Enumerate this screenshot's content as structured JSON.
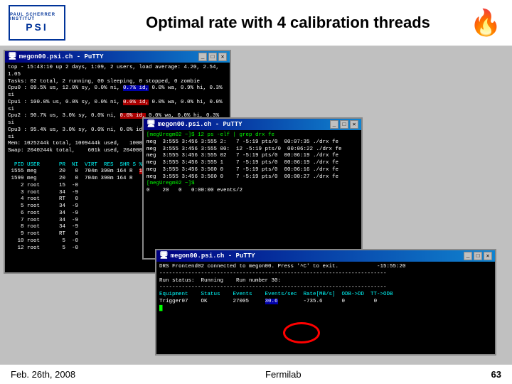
{
  "header": {
    "title": "Optimal rate with 4 calibration threads",
    "logo_text": "PSI",
    "logo_small": "PAUL SCHERRER INSTITUT"
  },
  "windows": [
    {
      "id": "win1",
      "title": "megon00.psi.ch - PuTTY",
      "lines": [
        "top - 15:43:10 up 2 days,  1:09, 2 users,  load average: 4.20, 2.54, 1.05",
        "Tasks:  02 total,   2 running, 00 sleeping,  0 stopped,  0 zombie",
        "Cpu0  :  09.5% us, 12.0% sy,  0.0% ni, [0.7% id,] 0.0% wa,  0.9% hi,  0.3% si",
        "Cpu1  : 100.0% us,  0.0% sy,  0.0% ni, [0.0% id,] 0.0% wa,  0.0% hi,  0.0% si",
        "Cpu2  :  90.7% us,  3.0% sy,  0.0% ni, [0.0% id,] 0.0% wa,  0.0% hi,  0.3% si",
        "Cpu3  :  95.4% us,  3.0% sy,  0.0% ni,  0.0% id,  0.0% wa,  0.0% hi,  0.0% si",
        "Mem:  1025244k total,  1009444k used,  1000005 free,  521306 buffers",
        "Swap: 2040244k total,    601k used,  2040004k free,  178250k cached",
        "",
        "  PID USER      PR  NI  VIRT  RES  SHR S %CPU %MEM    TIME+  COMMAND",
        " 1555 meg       20   0  704m 390m 164 R  [197] 09.0  1:32.00 drx fe",
        " 1599 meg       20   0  704m 390m 164 R   97  09.0  1:32.00 drx fe",
        "    2 root      15  -0                                              ",
        "    3 root      34  -9                                              ",
        "    4 root      RT   0                                              ",
        "    5 root      34  -9                                              ",
        "    6 root      34  -9                                              ",
        "    7 root      34  -9                                              ",
        "    8 root      34  -9                                              ",
        "    9 root      RT   0                                              ",
        "   10 root       5  -0                                              ",
        "   12 root       5  -0                                              "
      ]
    },
    {
      "id": "win2",
      "title": "megon00.psi.ch - PuTTY",
      "lines": [
        "[megUregm02 ~]$ 12 ps -elf | grep drx fe",
        "meg  3:555 3:456 3:555 2:   7 -5:19 pts/0  00:07:35 ./drx fe",
        "meg  3:555 3:456 3:555 00:  12 -5:19 pts/0  00:06:22 ./drx fe",
        "meg  3:555 3:456 3:555 02   7 -5:19 pts/0  00:06:19 ./drx fe",
        "meg  3:555 3:456 3:555 1    7 -5:19 pts/0  00:06:19 ./drx fe",
        "meg  3:555 3:456 3:560 0    7 -5:19 pts/0  00:06:16 ./drx fe",
        "meg  3:555 3:456 3:560 0    7 -5:19 pts/0  00:00:27 ./drx fe",
        "[megUregm02 ~]$",
        "0    20   0  0:00:00 events/2"
      ]
    },
    {
      "id": "win3",
      "title": "megon00.psi.ch - PuTTY",
      "lines": [
        "DRS Frontend02 connected to megon00. Press '^C' to exit.             -15:55:20",
        "-----------------------------------------------------------------------",
        "Run status:  Running    Run number 30:",
        "-----------------------------------------------------------------------",
        "Equipment    Status    Events    Events/sec  Rate[MB/s]  ODB->DD  TT->ODB",
        "Trigger07    OK        27005     30.6        -735.6      0        0"
      ]
    }
  ],
  "footer": {
    "date": "Feb. 26th, 2008",
    "org": "Fermilab",
    "page": "63"
  },
  "highlight": {
    "value": "30.6"
  }
}
